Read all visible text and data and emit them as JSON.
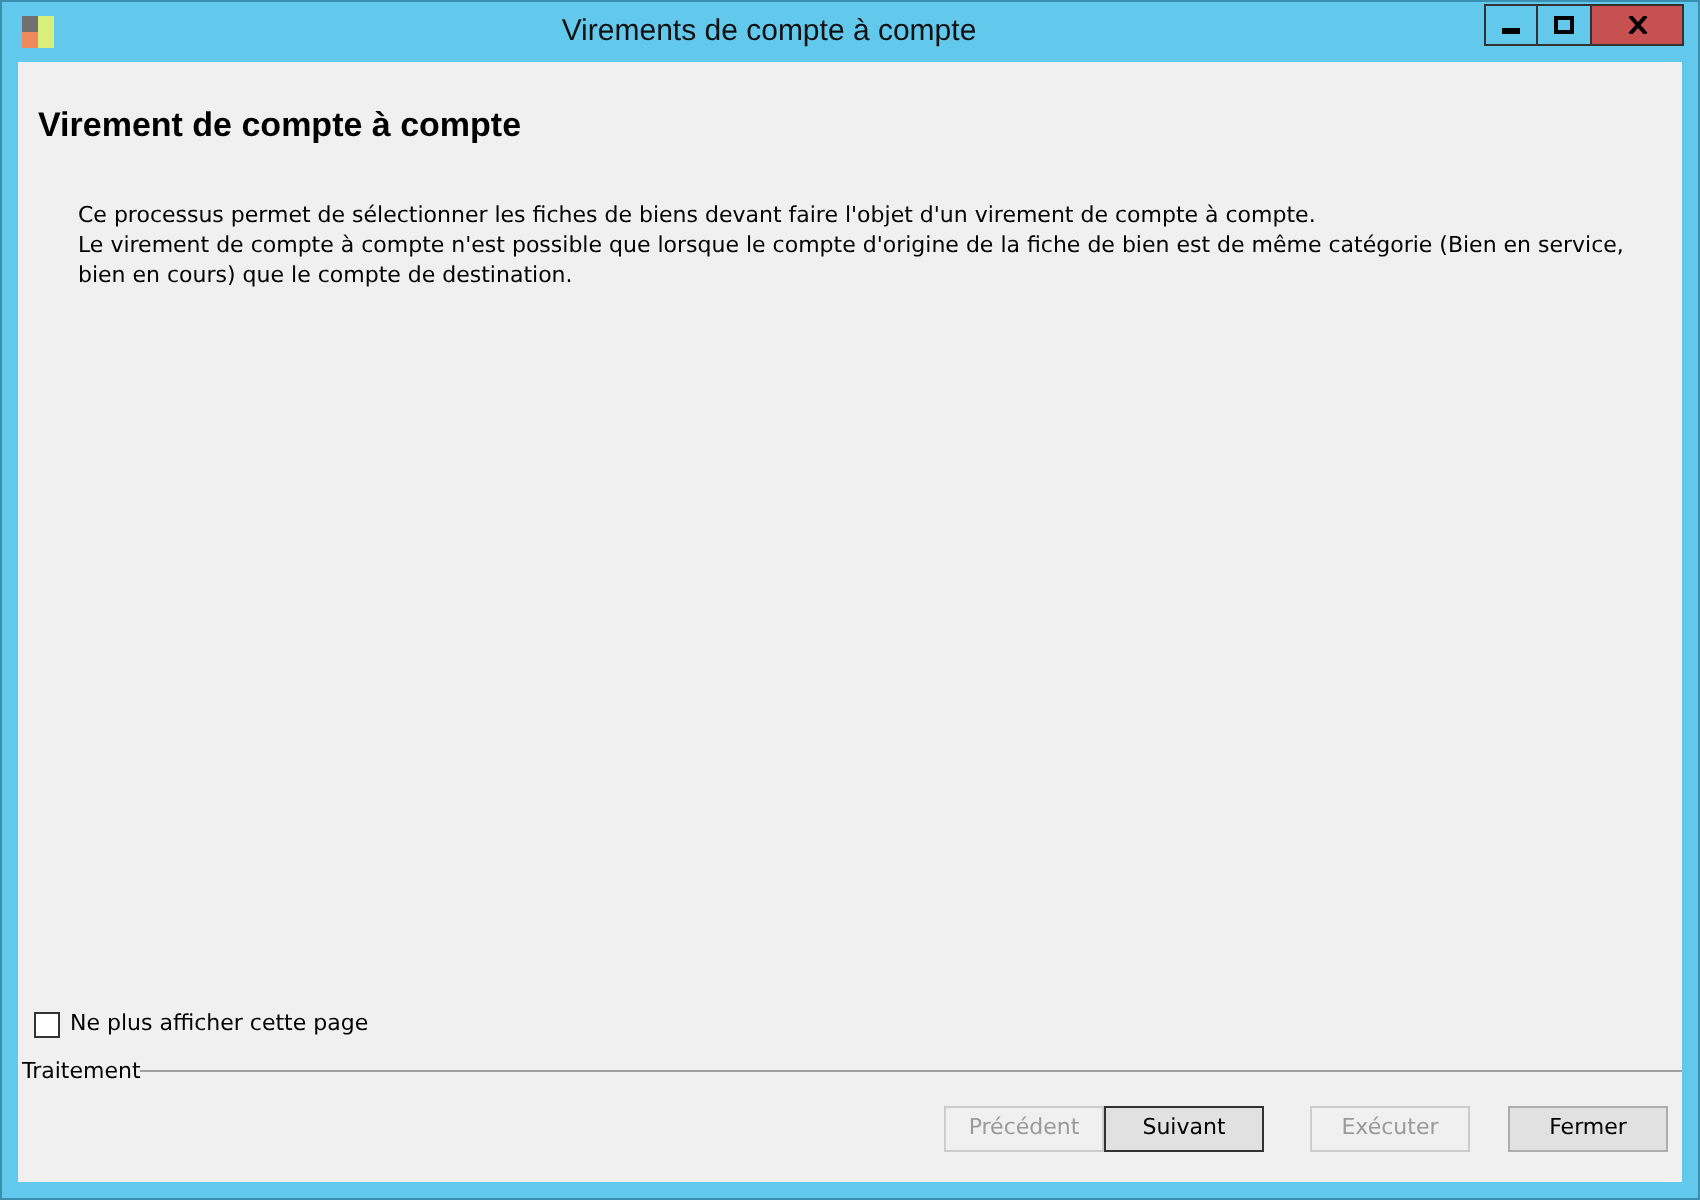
{
  "window": {
    "title": "Virements de compte à compte"
  },
  "heading": "Virement de compte à compte",
  "description": [
    "Ce processus permet de sélectionner les fiches de biens devant faire l'objet d'un virement de compte à compte.",
    "Le virement de compte à compte n'est possible que lorsque le compte d'origine de la fiche de bien est de même catégorie (Bien en service, bien en cours) que le compte de destination."
  ],
  "option": {
    "label": "Ne plus afficher cette page",
    "checked": false
  },
  "group": {
    "label": "Traitement"
  },
  "buttons": [
    {
      "label": "Précédent",
      "disabled": true,
      "default": false
    },
    {
      "label": "Suivant",
      "disabled": false,
      "default": true
    },
    {
      "label": "Exécuter",
      "disabled": true,
      "default": false
    },
    {
      "label": "Fermer",
      "disabled": false,
      "default": false
    }
  ]
}
